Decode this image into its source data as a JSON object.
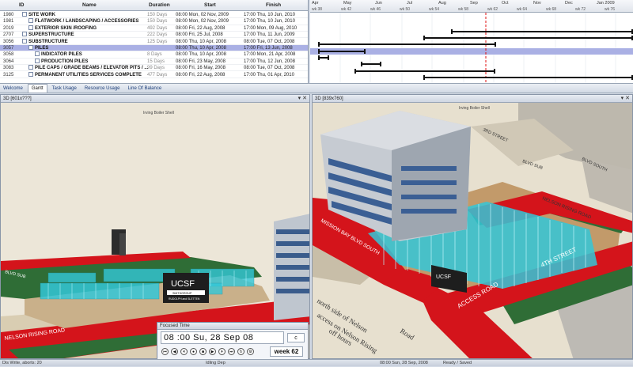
{
  "grid": {
    "headers": {
      "id": "ID",
      "name": "Name",
      "duration": "Duration",
      "start": "Start",
      "finish": "Finish"
    },
    "rows": [
      {
        "id": "1980",
        "name": "SITE WORK",
        "duration": "150 Days",
        "start": "08:00 Mon, 02 Nov, 2009",
        "finish": "17:00 Thu, 10 Jun, 2010",
        "level": 0
      },
      {
        "id": "1981",
        "name": "FLATWORK / LANDSCAPING / ACCESSORIES",
        "duration": "150 Days",
        "start": "08:00 Mon, 02 Nov, 2009",
        "finish": "17:00 Thu, 10 Jun, 2010",
        "level": 1
      },
      {
        "id": "2019",
        "name": "EXTERIOR SKIN /ROOFING",
        "duration": "492 Days",
        "start": "08:00 Fri, 22 Aug, 2008",
        "finish": "17:00 Mon, 09 Aug, 2010",
        "level": 1
      },
      {
        "id": "2707",
        "name": "SUPERSTRUCTURE",
        "duration": "222 Days",
        "start": "08:00 Fri, 25 Jul, 2008",
        "finish": "17:00 Thu, 11 Jun, 2009",
        "level": 0
      },
      {
        "id": "3056",
        "name": "SUBSTRUCTURE",
        "duration": "125 Days",
        "start": "08:00 Thu, 10 Apr, 2008",
        "finish": "08:00 Tue, 07 Oct, 2008",
        "level": 0
      },
      {
        "id": "3057",
        "name": "PILES",
        "duration": "",
        "start": "08:00 Thu, 10 Apr, 2008",
        "finish": "17:00 Fri, 13 Jun, 2008",
        "level": 1,
        "selected": true
      },
      {
        "id": "3058",
        "name": "INDICATOR PILES",
        "duration": "8 Days",
        "start": "08:00 Thu, 10 Apr, 2008",
        "finish": "17:00 Mon, 21 Apr, 2008",
        "level": 2
      },
      {
        "id": "3064",
        "name": "PRODUCTION PILES",
        "duration": "15 Days",
        "start": "08:00 Fri, 23 May, 2008",
        "finish": "17:00 Thu, 12 Jun, 2008",
        "level": 2
      },
      {
        "id": "3083",
        "name": "PILE CAPS / GRADE BEAMS / ELEVATOR PITS / ...",
        "duration": "99 Days",
        "start": "08:00 Fri, 16 May, 2008",
        "finish": "08:00 Tue, 07 Oct, 2008",
        "level": 1
      },
      {
        "id": "3125",
        "name": "PERMANENT UTILITIES SERVICES COMPLETE",
        "duration": "477 Days",
        "start": "08:00 Fri, 22 Aug, 2008",
        "finish": "17:00 Thu, 01 Apr, 2010",
        "level": 1
      }
    ]
  },
  "gantt": {
    "months": [
      "Apr",
      "May",
      "Jun",
      "Jul",
      "Aug",
      "Sep",
      "Oct",
      "Nov",
      "Dec",
      "Jan 2009"
    ],
    "weeks": [
      "wk 38",
      "wk 42",
      "wk 46",
      "wk 50",
      "wk 54",
      "wk 58",
      "wk 62",
      "wk 64",
      "wk 68",
      "wk 72",
      "wk 76"
    ]
  },
  "tabs": [
    "Welcome",
    "Gantt",
    "Task Usage",
    "Resource Usage",
    "Line Of Balance"
  ],
  "active_tab": "Gantt",
  "left_panel": {
    "title": "3D [601x???]",
    "caption": "Irving Boiler Shell"
  },
  "right_panel": {
    "title": "3D [839x760]",
    "caption": "Irving Boiler Shell"
  },
  "map_labels": {
    "nelson_rising_road": "NELSON RISING ROAD",
    "mission_bay_blvd_south": "MISSION BAY BLVD SOUTH",
    "access_road": "ACCESS ROAD",
    "fourth_street": "4TH STREET",
    "third_street": "3RD STREET",
    "blvd_south": "BLVD SOUTH",
    "blvd_sub": "BLVD SUB",
    "ucsf": "UCSF",
    "sign_line1": "SMITHGROUP",
    "sign_line2": "RUDOLPH and SLETTEN",
    "note_line1": "north side of Nelson",
    "note_line2": "access on Nelson Rising",
    "note_line3": "off hours",
    "note_line4": "Road"
  },
  "focused_time": {
    "title": "Focused Time",
    "time": "08 :00  Su,   28  Sep  08",
    "selector": "c",
    "week": "week 62"
  },
  "status": {
    "left": "Dis Write, aborts: 20",
    "mid": "Idling Dep",
    "right_a": "08:00 Sun, 28 Sep, 2008",
    "right_b": "Ready / Saved"
  }
}
